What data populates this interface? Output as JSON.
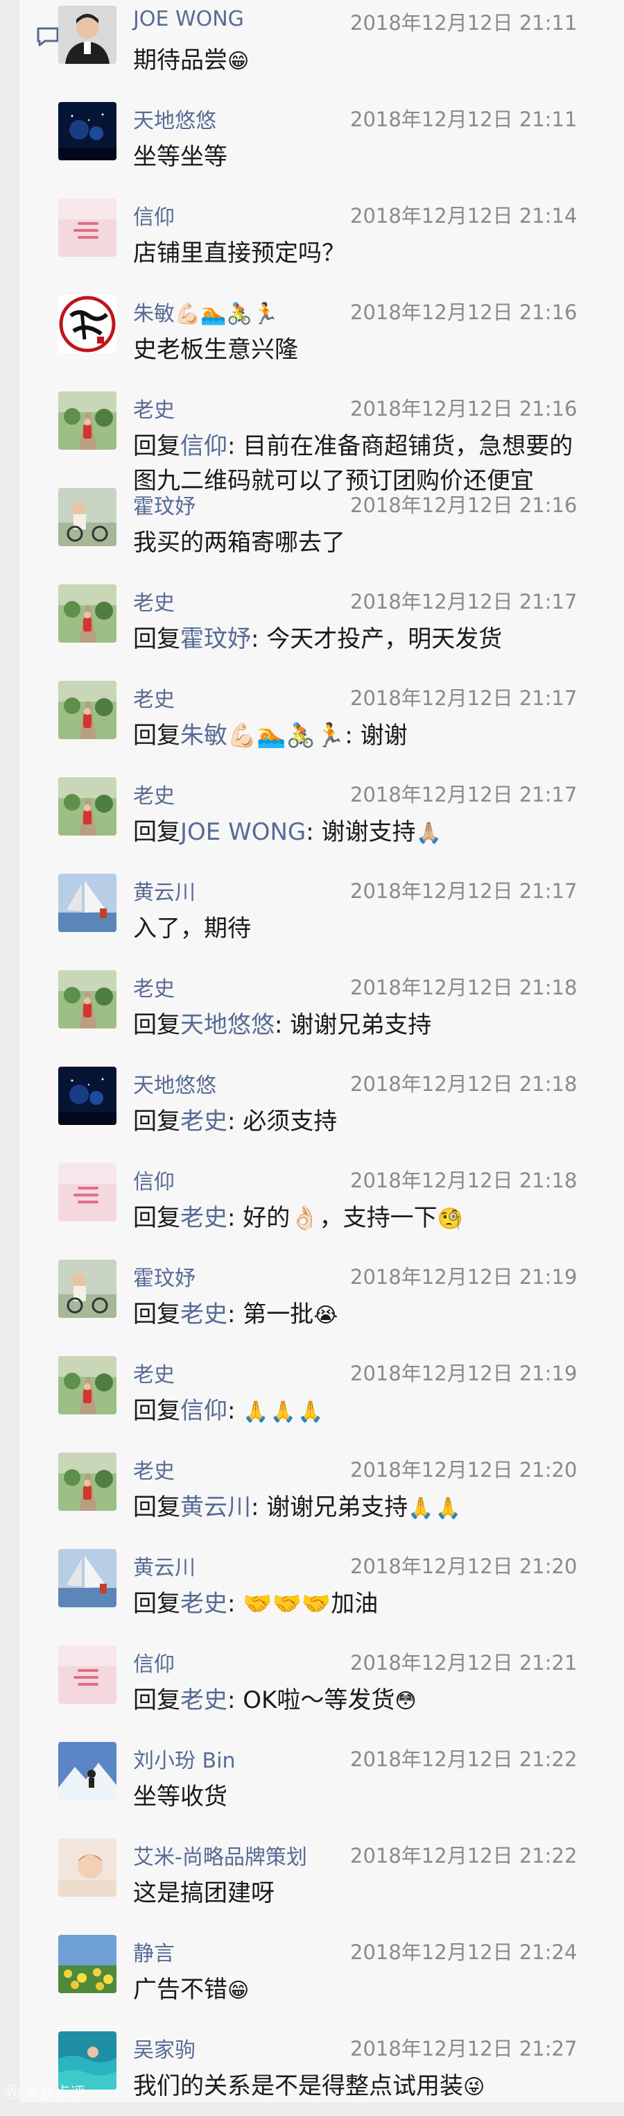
{
  "watermark": "Ⓦ 大众点评",
  "comments": [
    {
      "name": "JOE WONG",
      "time": "2018年12月12日 21:11",
      "text": "期待品尝",
      "emoji": "😁",
      "avatar": "portrait"
    },
    {
      "name": "天地悠悠",
      "time": "2018年12月12日 21:11",
      "text": "坐等坐等",
      "avatar": "night"
    },
    {
      "name": "信仰",
      "time": "2018年12月12日 21:14",
      "text": "店铺里直接预定吗？",
      "avatar": "pink"
    },
    {
      "name": "朱敏💪🏻🏊🚴🏃",
      "time": "2018年12月12日 21:16",
      "text": "史老板生意兴隆",
      "avatar": "calligraphy"
    },
    {
      "name": "老史",
      "time": "2018年12月12日 21:16",
      "prefix": "回复",
      "reply_to": "信仰",
      "text": ": 目前在准备商超铺货，急想要的图九二维码就可以了预订团购价还便宜",
      "avatar": "road"
    },
    {
      "name": "霍玟妤",
      "time": "2018年12月12日 21:16",
      "text": "我买的两箱寄哪去了",
      "avatar": "bike"
    },
    {
      "name": "老史",
      "time": "2018年12月12日 21:17",
      "prefix": "回复",
      "reply_to": "霍玟妤",
      "text": ": 今天才投产，明天发货",
      "avatar": "road"
    },
    {
      "name": "老史",
      "time": "2018年12月12日 21:17",
      "prefix": "回复",
      "reply_to": "朱敏💪🏻🏊🚴🏃",
      "text": ": 谢谢",
      "avatar": "road"
    },
    {
      "name": "老史",
      "time": "2018年12月12日 21:17",
      "prefix": "回复",
      "reply_to": "JOE WONG",
      "text": ": 谢谢支持",
      "emoji": "🙏🏼",
      "avatar": "road"
    },
    {
      "name": "黄云川",
      "time": "2018年12月12日 21:17",
      "text": "入了，期待",
      "avatar": "sail"
    },
    {
      "name": "老史",
      "time": "2018年12月12日 21:18",
      "prefix": "回复",
      "reply_to": "天地悠悠",
      "text": ": 谢谢兄弟支持",
      "avatar": "road"
    },
    {
      "name": "天地悠悠",
      "time": "2018年12月12日 21:18",
      "prefix": "回复",
      "reply_to": "老史",
      "text": ": 必须支持",
      "avatar": "night"
    },
    {
      "name": "信仰",
      "time": "2018年12月12日 21:18",
      "prefix": "回复",
      "reply_to": "老史",
      "text": ": 好的👌🏻，支持一下",
      "emoji": "🧐",
      "avatar": "pink"
    },
    {
      "name": "霍玟妤",
      "time": "2018年12月12日 21:19",
      "prefix": "回复",
      "reply_to": "老史",
      "text": ": 第一批",
      "emoji": "😭",
      "avatar": "bike"
    },
    {
      "name": "老史",
      "time": "2018年12月12日 21:19",
      "prefix": "回复",
      "reply_to": "信仰",
      "text": ": ",
      "emoji": "🙏🙏🙏",
      "avatar": "road"
    },
    {
      "name": "老史",
      "time": "2018年12月12日 21:20",
      "prefix": "回复",
      "reply_to": "黄云川",
      "text": ": 谢谢兄弟支持",
      "emoji": "🙏🙏",
      "avatar": "road"
    },
    {
      "name": "黄云川",
      "time": "2018年12月12日 21:20",
      "prefix": "回复",
      "reply_to": "老史",
      "text": ": 🤝🤝🤝加油",
      "avatar": "sail"
    },
    {
      "name": "信仰",
      "time": "2018年12月12日 21:21",
      "prefix": "回复",
      "reply_to": "老史",
      "text": ": OK啦～等发货",
      "emoji": "😳",
      "avatar": "pink"
    },
    {
      "name": "刘小玢 Bin",
      "time": "2018年12月12日 21:22",
      "text": "坐等收货",
      "avatar": "mountain"
    },
    {
      "name": "艾米-尚略品牌策划",
      "time": "2018年12月12日 21:22",
      "text": "这是搞团建呀",
      "avatar": "baby"
    },
    {
      "name": "静言",
      "time": "2018年12月12日 21:24",
      "text": "广告不错",
      "emoji": "😁",
      "avatar": "flowers"
    },
    {
      "name": "吴家驹",
      "time": "2018年12月12日 21:27",
      "text": "我们的关系是不是得整点试用装",
      "emoji": "😜",
      "avatar": "sea"
    }
  ]
}
